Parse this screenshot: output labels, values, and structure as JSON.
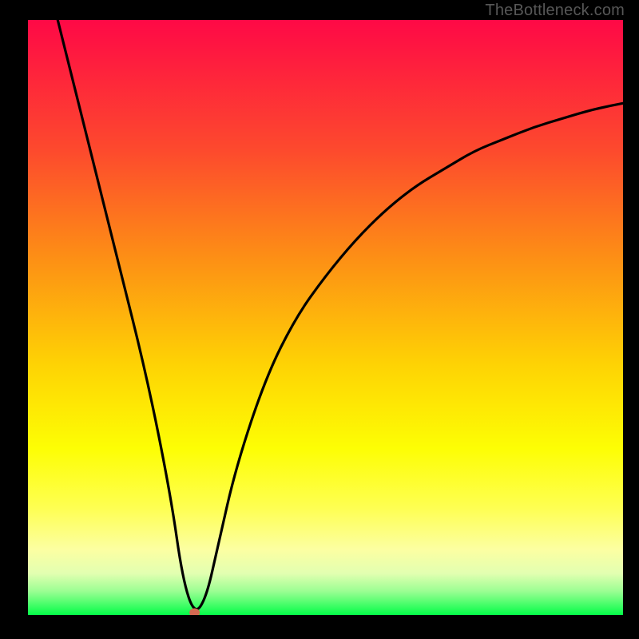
{
  "source_label": "TheBottleneck.com",
  "chart_data": {
    "type": "line",
    "title": "",
    "xlabel": "",
    "ylabel": "",
    "xlim": [
      0,
      100
    ],
    "ylim": [
      0,
      100
    ],
    "series": [
      {
        "name": "curve",
        "x": [
          5,
          10,
          15,
          20,
          24,
          26,
          28,
          30,
          32,
          35,
          40,
          45,
          50,
          55,
          60,
          65,
          70,
          75,
          80,
          85,
          90,
          95,
          100
        ],
        "y": [
          100,
          80,
          60,
          40,
          20,
          6,
          0,
          3,
          12,
          25,
          40,
          50,
          57,
          63,
          68,
          72,
          75,
          78,
          80,
          82,
          83.5,
          85,
          86
        ]
      }
    ],
    "minimum_point": {
      "x": 28,
      "y": 0
    },
    "gradient_colors": {
      "top": "#fe0946",
      "mid_upper": "#fc721e",
      "mid": "#fed304",
      "mid_lower": "#fdfe04",
      "mid_yellow": "#fcff74",
      "bottom": "#04fd48"
    }
  }
}
